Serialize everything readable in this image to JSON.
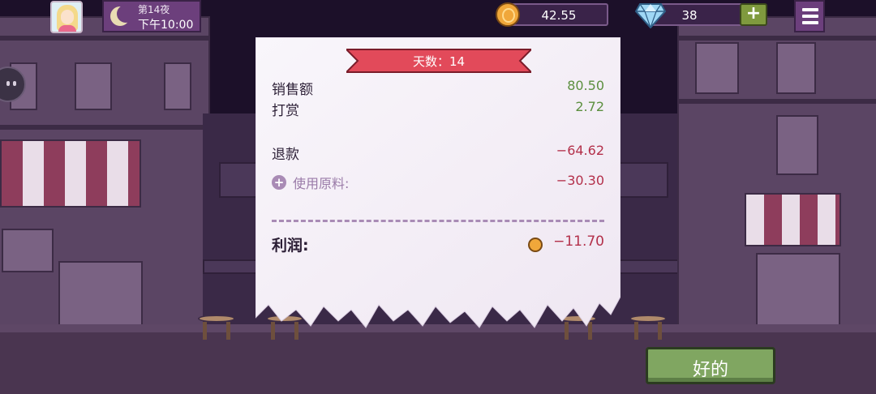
{
  "hud": {
    "night_label": "第14夜",
    "time_label": "下午10:00",
    "coins": "42.55",
    "gems": "38",
    "add_gems_label": "+"
  },
  "receipt": {
    "day_banner": "天数：14",
    "rows": [
      {
        "label": "销售额",
        "value": "80.50"
      },
      {
        "label": "打赏",
        "value": "2.72"
      },
      {
        "label": "退款",
        "value": "−64.62"
      },
      {
        "label": "使用原料:",
        "value": "−30.30"
      }
    ],
    "profit": {
      "label": "利润:",
      "value": "−11.70"
    }
  },
  "ok_button": {
    "label": "好的"
  },
  "colors": {
    "positive": "#5c8f3f",
    "negative": "#b3304a",
    "banner": "#e24a5a",
    "ok_button": "#80a661",
    "hud_purple": "#6c3f7c"
  }
}
